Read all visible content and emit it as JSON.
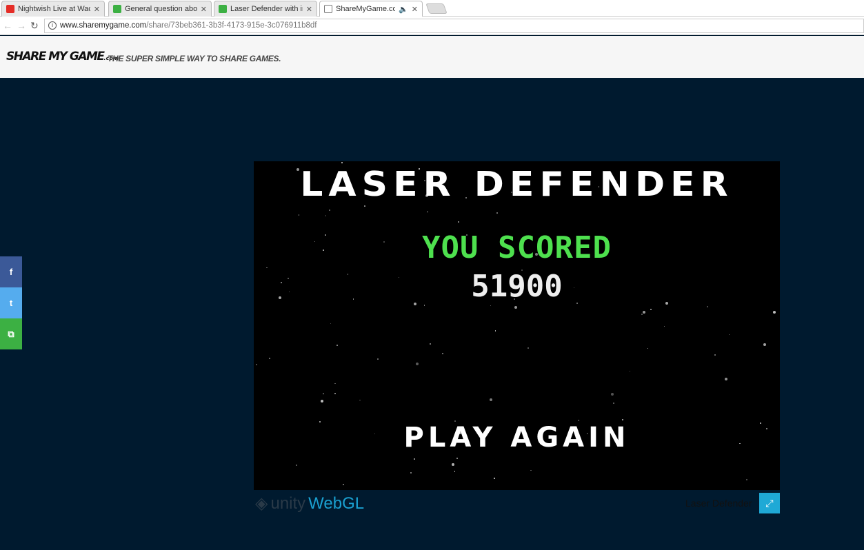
{
  "browser": {
    "tabs": [
      {
        "title": "Nightwish Live at Wacken",
        "icon": "youtube-icon",
        "color": "#e52d27"
      },
      {
        "title": "General question about Unity",
        "icon": "sharemygame-icon",
        "color": "#3cb043"
      },
      {
        "title": "Laser Defender with increased",
        "icon": "sharemygame-icon",
        "color": "#3cb043"
      },
      {
        "title": "ShareMyGame.com",
        "icon": "page-icon",
        "color": "#ffffff"
      }
    ],
    "url_host": "www.sharemygame.com",
    "url_path": "/share/73beb361-3b3f-4173-915e-3c076911b8df",
    "info": "i"
  },
  "header": {
    "logo": "SHARE MY GAME",
    "logo_suffix": ".com",
    "tagline": "THE SUPER SIMPLE WAY TO SHARE GAMES."
  },
  "social": [
    {
      "name": "facebook",
      "glyph": "f",
      "color": "#3b5998"
    },
    {
      "name": "twitter",
      "glyph": "t",
      "color": "#55acee"
    },
    {
      "name": "sharemygame",
      "glyph": "⧉",
      "color": "#3cb043"
    }
  ],
  "game": {
    "title": "LASER DEFENDER",
    "scored": "YOU SCORED",
    "score": "51900",
    "play_again": "PLAY AGAIN"
  },
  "footer": {
    "unity": "unity",
    "webgl": "WebGL",
    "game_name": "Laser Defender",
    "fullscreen": "⤢"
  }
}
